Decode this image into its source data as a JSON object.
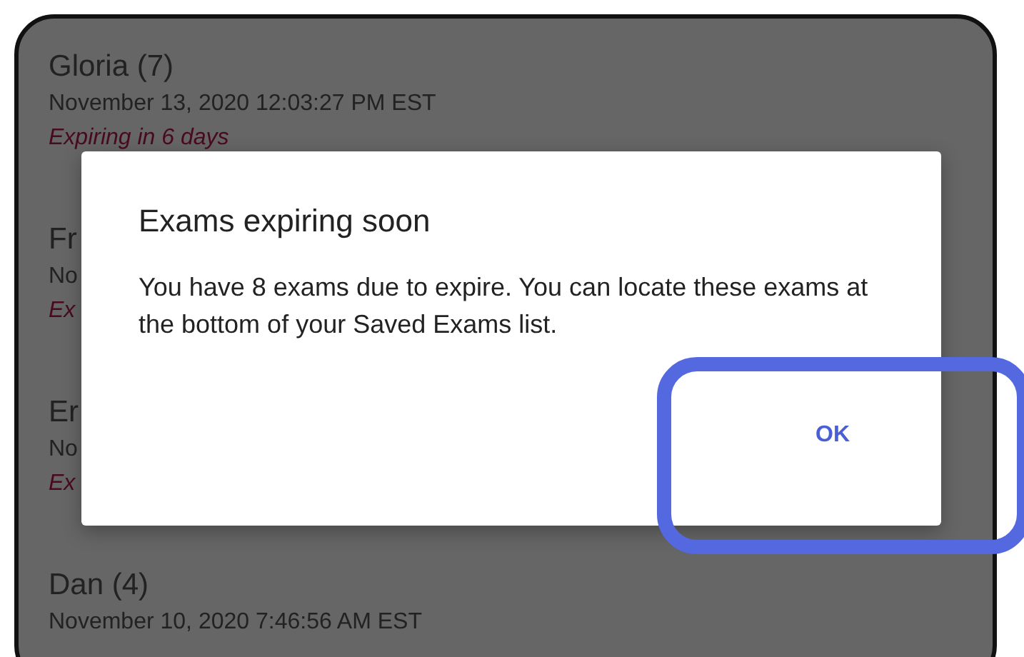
{
  "exams": [
    {
      "name": "Gloria (7)",
      "date": "November 13, 2020 12:03:27 PM EST",
      "expiry": "Expiring in 6 days"
    },
    {
      "name": "Fr",
      "date": "No",
      "expiry": "Ex"
    },
    {
      "name": "Er",
      "date": "No",
      "expiry": "Ex"
    },
    {
      "name": "Dan (4)",
      "date": "November 10, 2020 7:46:56 AM EST"
    }
  ],
  "dialog": {
    "title": "Exams expiring soon",
    "message": "You have 8 exams due to expire. You can locate these exams at the bottom of your Saved Exams list.",
    "buttons": [
      "OK"
    ],
    "highlighted_button": true
  }
}
